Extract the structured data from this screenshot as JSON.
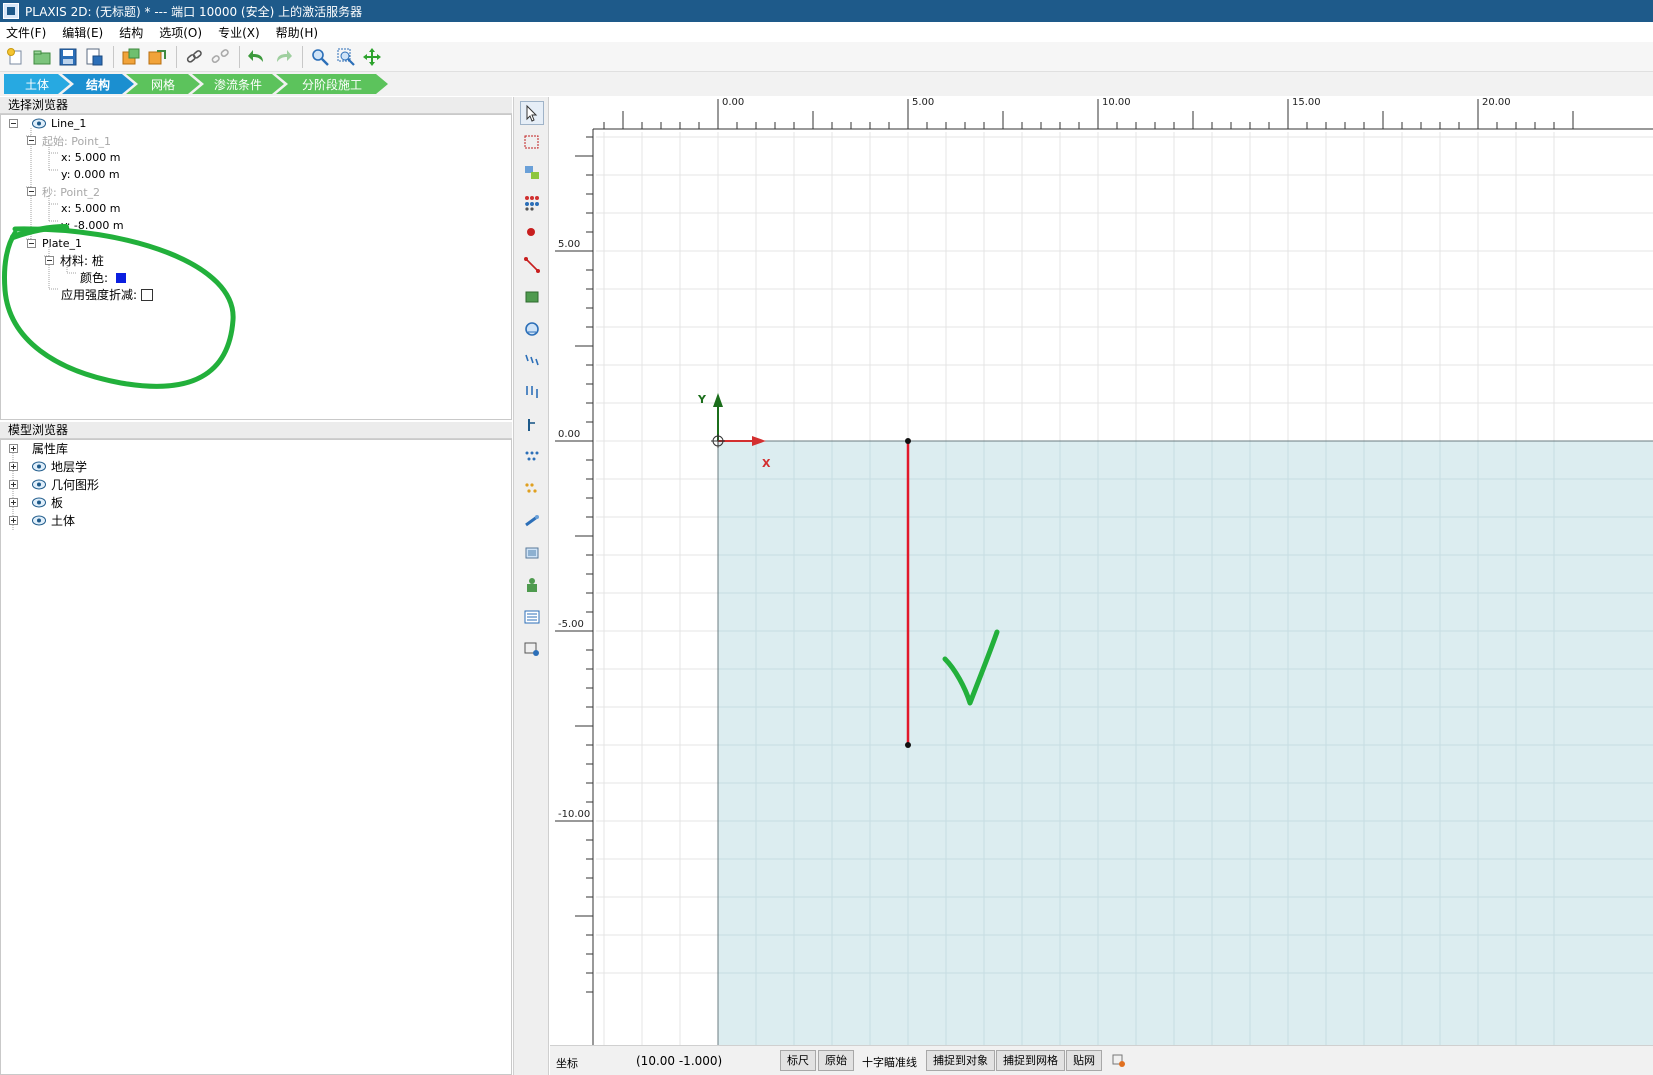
{
  "window": {
    "title": "PLAXIS 2D: (无标题) * --- 端口 10000 (安全) 上的激活服务器"
  },
  "menu": [
    "文件(F)",
    "编辑(E)",
    "结构",
    "选项(O)",
    "专业(X)",
    "帮助(H)"
  ],
  "toolbar": {
    "icons": [
      "new-project",
      "open-project",
      "save-project",
      "save-as",
      "import-geometry",
      "export-geometry",
      "link",
      "unlink",
      "undo",
      "redo",
      "zoom-in",
      "zoom-window",
      "pan"
    ]
  },
  "modes": [
    {
      "label": "土体",
      "state": "done"
    },
    {
      "label": "结构",
      "state": "active"
    },
    {
      "label": "网格",
      "state": "pending"
    },
    {
      "label": "渗流条件",
      "state": "pending"
    },
    {
      "label": "分阶段施工",
      "state": "pending"
    }
  ],
  "selection_browser": {
    "title": "选择浏览器",
    "line": "Line_1",
    "start_label": "起始: Point_1",
    "start_x": "x: 5.000 m",
    "start_y": "y: 0.000 m",
    "end_label": "秒: Point_2",
    "end_x": "x: 5.000 m",
    "end_y": "y: -8.000 m",
    "plate": "Plate_1",
    "material": "材料: 桩",
    "color_label": "颜色:",
    "plate_color": "#0b1fe0",
    "strength_reduction": "应用强度折减:"
  },
  "model_browser": {
    "title": "模型浏览器",
    "items": [
      "属性库",
      "地层学",
      "几何图形",
      "板",
      "土体"
    ]
  },
  "side_tools": [
    "select-arrow",
    "select-rectangle",
    "move",
    "copy-array",
    "create-point",
    "create-line",
    "create-polygon",
    "create-tunnel",
    "create-line-load",
    "create-point-load",
    "create-anchor",
    "create-interface",
    "create-embedded-beam",
    "create-drain",
    "create-well",
    "create-structure",
    "material-sets",
    "model-info"
  ],
  "canvas": {
    "x_ticks": [
      "0.00",
      "5.00",
      "10.00",
      "15.00",
      "20.00"
    ],
    "y_ticks": [
      "5.00",
      "0.00",
      "-5.00",
      "-10.00"
    ],
    "axis_x_label": "X",
    "axis_y_label": "Y",
    "colors": {
      "soil_fill": "#dcedf0",
      "plate_line": "#e1182a",
      "annotation": "#22b03b",
      "axis_x": "#d32f2f",
      "axis_y": "#1b6e1b"
    },
    "soil": {
      "x_min": 0,
      "x_max": 22.8,
      "y_min": -14.5,
      "y_max": 0
    },
    "plate": {
      "x": 5.0,
      "y_start": 0.0,
      "y_end": -8.0
    },
    "view": {
      "x_min": -4.0,
      "x_max": 22.8,
      "y_min": -14.5,
      "y_max": 8.3,
      "grid_step": 1.0,
      "minor_tick": 0.5
    }
  },
  "status": {
    "coord_label": "坐标",
    "coord_value": "(10.00 -1.000)",
    "buttons": [
      "标尺",
      "原始",
      "十字瞄准线",
      "捕捉到对象",
      "捕捉到网格",
      "贴网"
    ]
  }
}
